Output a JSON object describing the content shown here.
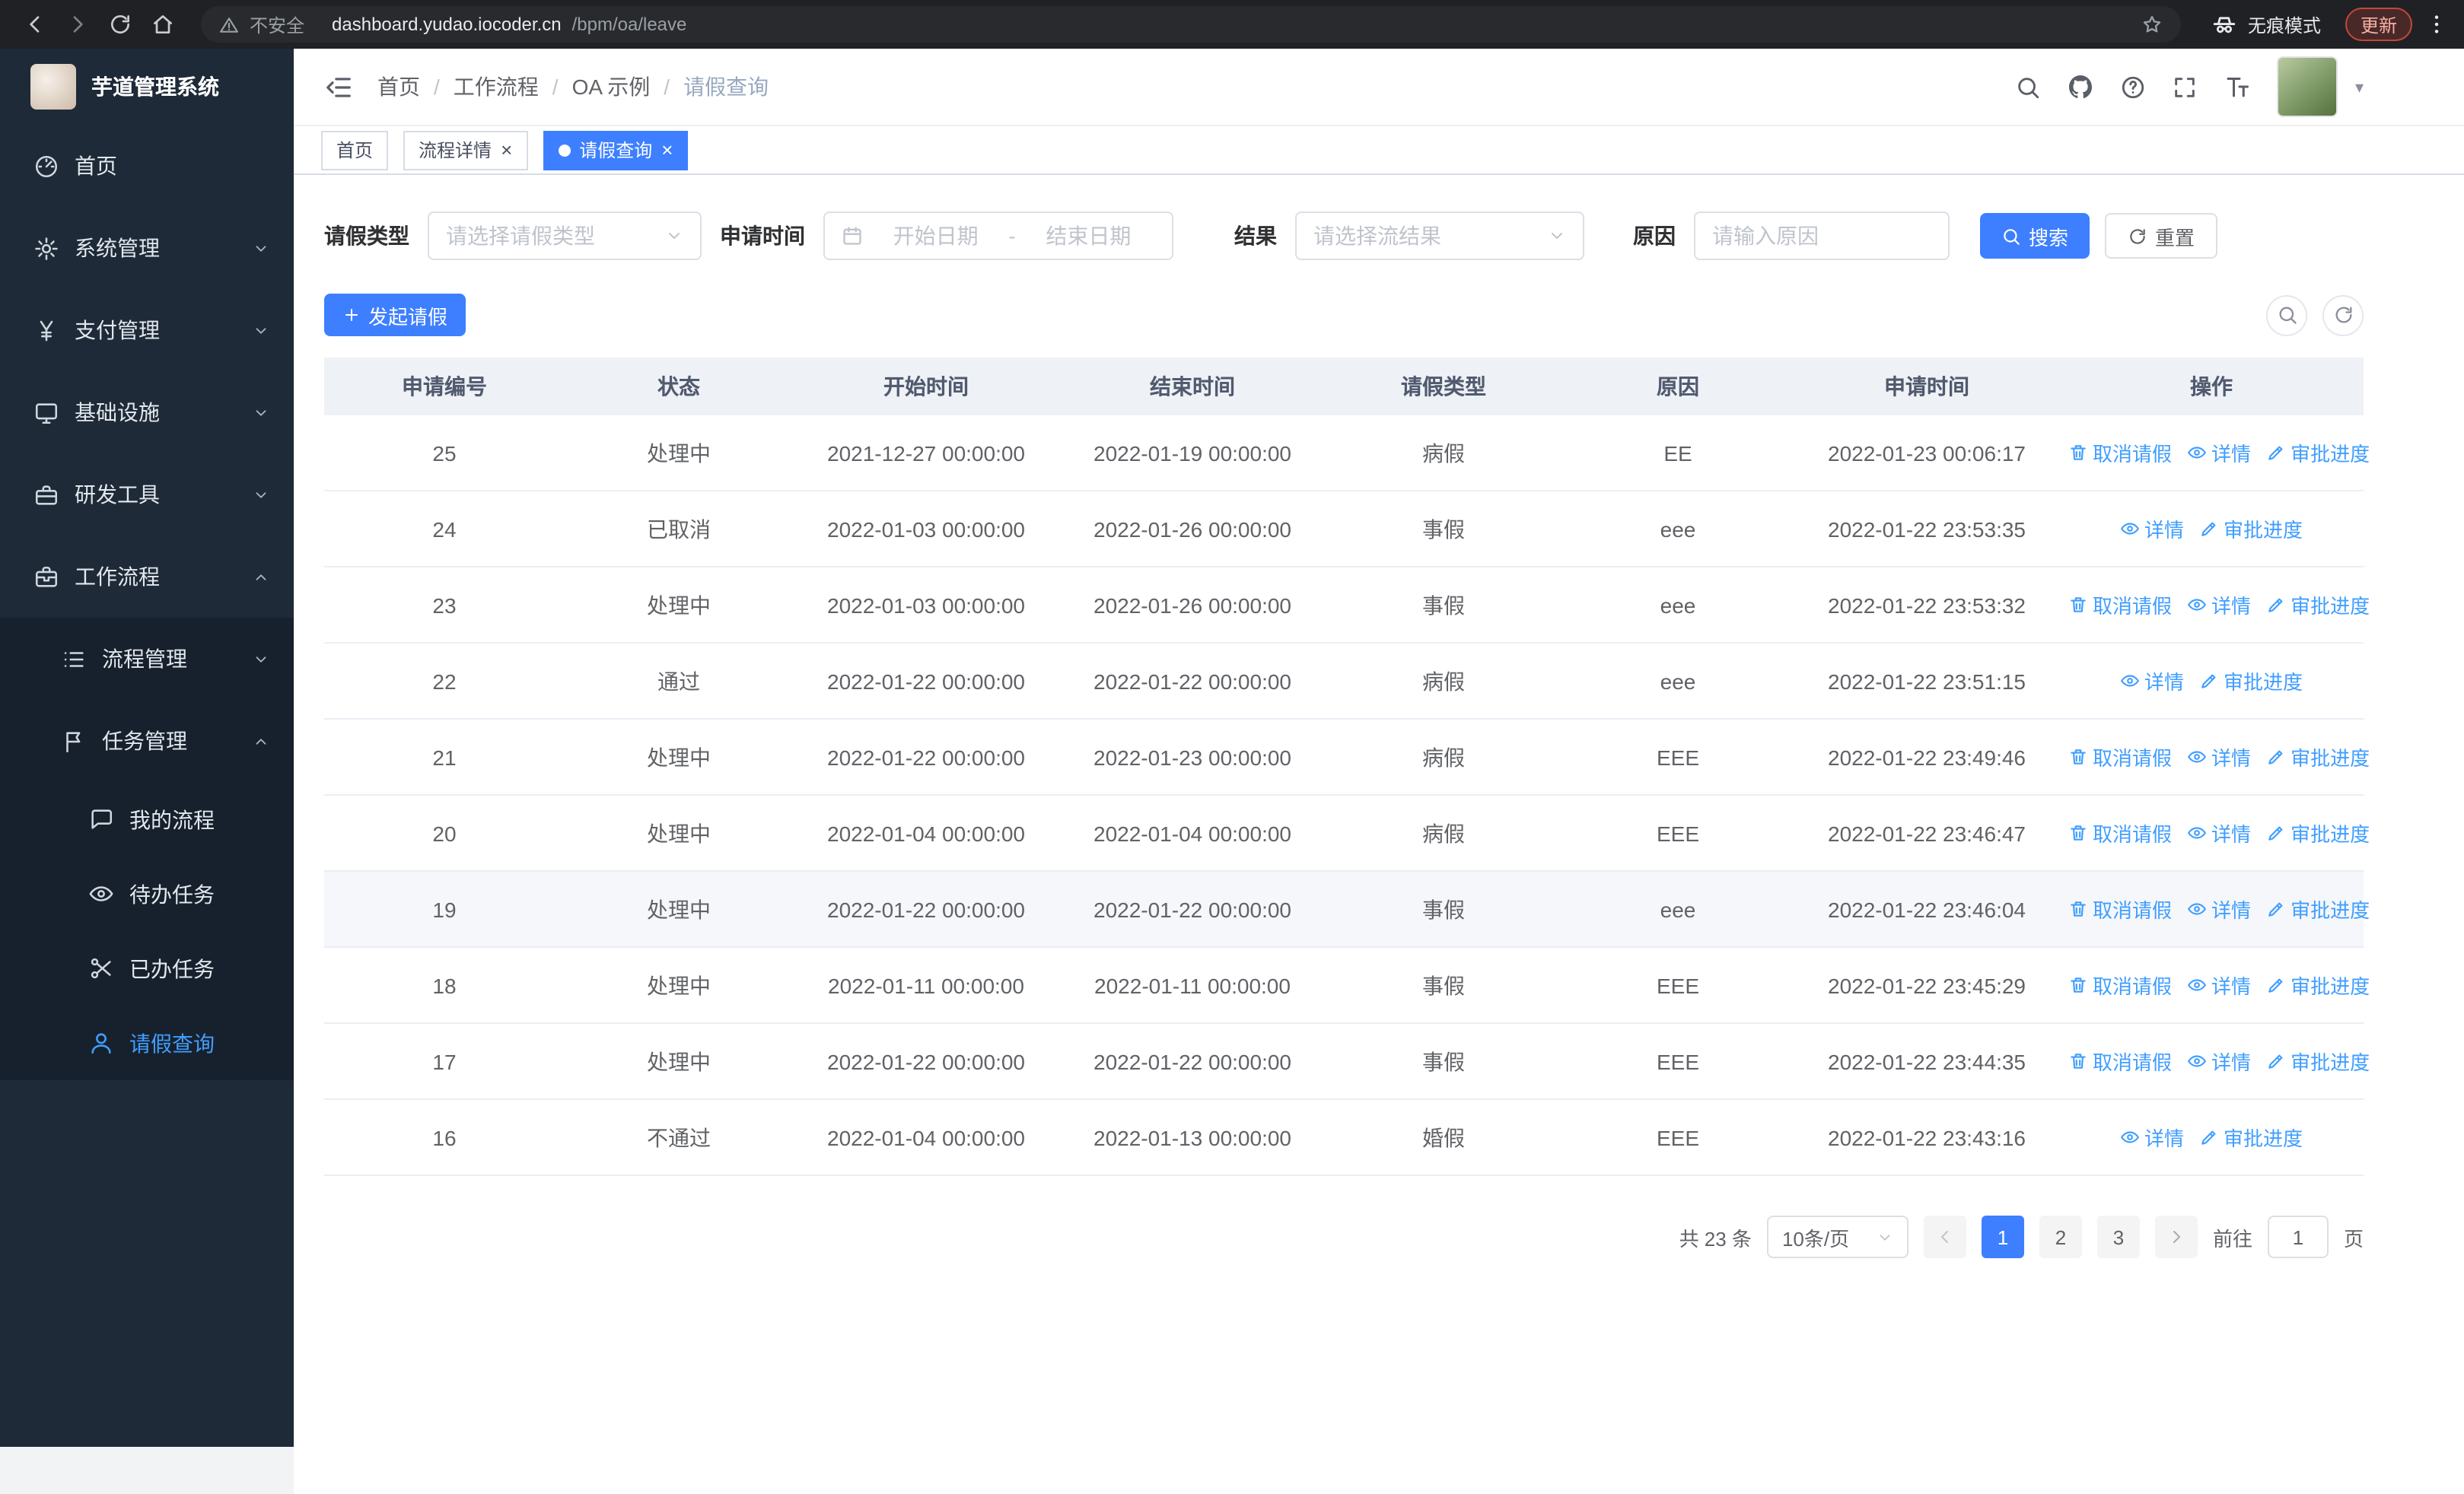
{
  "browser": {
    "security_warning": "不安全",
    "url_domain": "dashboard.yudao.iocoder.cn",
    "url_path": "/bpm/oa/leave",
    "incognito_label": "无痕模式",
    "update_label": "更新"
  },
  "sidebar": {
    "title": "芋道管理系统",
    "items": [
      {
        "key": "home",
        "label": "首页",
        "icon": "dashboard-icon",
        "level": 1
      },
      {
        "key": "system",
        "label": "系统管理",
        "icon": "gear-icon",
        "level": 1,
        "chevron": "down"
      },
      {
        "key": "payment",
        "label": "支付管理",
        "icon": "yen-icon",
        "level": 1,
        "chevron": "down"
      },
      {
        "key": "infra",
        "label": "基础设施",
        "icon": "monitor-icon",
        "level": 1,
        "chevron": "down"
      },
      {
        "key": "devtools",
        "label": "研发工具",
        "icon": "toolbox-icon",
        "level": 1,
        "chevron": "down"
      },
      {
        "key": "workflow",
        "label": "工作流程",
        "icon": "briefcase-icon",
        "level": 1,
        "chevron": "up"
      },
      {
        "key": "process-mgmt",
        "label": "流程管理",
        "icon": "list-icon",
        "level": 2,
        "chevron": "down",
        "sub": true
      },
      {
        "key": "task-mgmt",
        "label": "任务管理",
        "icon": "flag-icon",
        "level": 2,
        "chevron": "up",
        "sub": true
      },
      {
        "key": "my-process",
        "label": "我的流程",
        "icon": "chat-icon",
        "level": 3,
        "sub": true
      },
      {
        "key": "todo-task",
        "label": "待办任务",
        "icon": "eye-icon",
        "level": 3,
        "sub": true
      },
      {
        "key": "done-task",
        "label": "已办任务",
        "icon": "scissors-icon",
        "level": 3,
        "sub": true
      },
      {
        "key": "leave-query",
        "label": "请假查询",
        "icon": "user-icon",
        "level": 3,
        "sub": true,
        "active": true
      }
    ]
  },
  "header": {
    "breadcrumb": [
      "首页",
      "工作流程",
      "OA 示例",
      "请假查询"
    ]
  },
  "tabs": [
    {
      "label": "首页"
    },
    {
      "label": "流程详情"
    },
    {
      "label": "请假查询",
      "active": true
    }
  ],
  "filters": {
    "leave_type_label": "请假类型",
    "leave_type_placeholder": "请选择请假类型",
    "apply_time_label": "申请时间",
    "date_start_placeholder": "开始日期",
    "date_separator": "-",
    "date_end_placeholder": "结束日期",
    "result_label": "结果",
    "result_placeholder": "请选择流结果",
    "reason_label": "原因",
    "reason_placeholder": "请输入原因",
    "search_label": "搜索",
    "reset_label": "重置"
  },
  "toolbar": {
    "create_label": "发起请假"
  },
  "table": {
    "columns": [
      "申请编号",
      "状态",
      "开始时间",
      "结束时间",
      "请假类型",
      "原因",
      "申请时间",
      "操作"
    ],
    "action_labels": {
      "cancel": "取消请假",
      "detail": "详情",
      "progress": "审批进度"
    },
    "rows": [
      {
        "id": "25",
        "status": "处理中",
        "start": "2021-12-27 00:00:00",
        "end": "2022-01-19 00:00:00",
        "type": "病假",
        "reason": "EE",
        "applied": "2022-01-23 00:06:17",
        "actions": [
          "cancel",
          "detail",
          "progress"
        ]
      },
      {
        "id": "24",
        "status": "已取消",
        "start": "2022-01-03 00:00:00",
        "end": "2022-01-26 00:00:00",
        "type": "事假",
        "reason": "eee",
        "applied": "2022-01-22 23:53:35",
        "actions": [
          "detail",
          "progress"
        ]
      },
      {
        "id": "23",
        "status": "处理中",
        "start": "2022-01-03 00:00:00",
        "end": "2022-01-26 00:00:00",
        "type": "事假",
        "reason": "eee",
        "applied": "2022-01-22 23:53:32",
        "actions": [
          "cancel",
          "detail",
          "progress"
        ]
      },
      {
        "id": "22",
        "status": "通过",
        "start": "2022-01-22 00:00:00",
        "end": "2022-01-22 00:00:00",
        "type": "病假",
        "reason": "eee",
        "applied": "2022-01-22 23:51:15",
        "actions": [
          "detail",
          "progress"
        ]
      },
      {
        "id": "21",
        "status": "处理中",
        "start": "2022-01-22 00:00:00",
        "end": "2022-01-23 00:00:00",
        "type": "病假",
        "reason": "EEE",
        "applied": "2022-01-22 23:49:46",
        "actions": [
          "cancel",
          "detail",
          "progress"
        ]
      },
      {
        "id": "20",
        "status": "处理中",
        "start": "2022-01-04 00:00:00",
        "end": "2022-01-04 00:00:00",
        "type": "病假",
        "reason": "EEE",
        "applied": "2022-01-22 23:46:47",
        "actions": [
          "cancel",
          "detail",
          "progress"
        ]
      },
      {
        "id": "19",
        "status": "处理中",
        "start": "2022-01-22 00:00:00",
        "end": "2022-01-22 00:00:00",
        "type": "事假",
        "reason": "eee",
        "applied": "2022-01-22 23:46:04",
        "actions": [
          "cancel",
          "detail",
          "progress"
        ],
        "highlight": true
      },
      {
        "id": "18",
        "status": "处理中",
        "start": "2022-01-11 00:00:00",
        "end": "2022-01-11 00:00:00",
        "type": "事假",
        "reason": "EEE",
        "applied": "2022-01-22 23:45:29",
        "actions": [
          "cancel",
          "detail",
          "progress"
        ]
      },
      {
        "id": "17",
        "status": "处理中",
        "start": "2022-01-22 00:00:00",
        "end": "2022-01-22 00:00:00",
        "type": "事假",
        "reason": "EEE",
        "applied": "2022-01-22 23:44:35",
        "actions": [
          "cancel",
          "detail",
          "progress"
        ]
      },
      {
        "id": "16",
        "status": "不通过",
        "start": "2022-01-04 00:00:00",
        "end": "2022-01-13 00:00:00",
        "type": "婚假",
        "reason": "EEE",
        "applied": "2022-01-22 23:43:16",
        "actions": [
          "detail",
          "progress"
        ]
      }
    ]
  },
  "pagination": {
    "total_label": "共 23 条",
    "page_size": "10条/页",
    "pages": [
      "1",
      "2",
      "3"
    ],
    "active_page": "1",
    "goto_label": "前往",
    "goto_value": "1",
    "page_unit_label": "页"
  },
  "colors": {
    "accent": "#3d7fff",
    "link": "#409eff",
    "sidebar_bg": "#1e2a38",
    "submenu_bg": "#17212d",
    "table_header_bg": "#eef1f6"
  }
}
